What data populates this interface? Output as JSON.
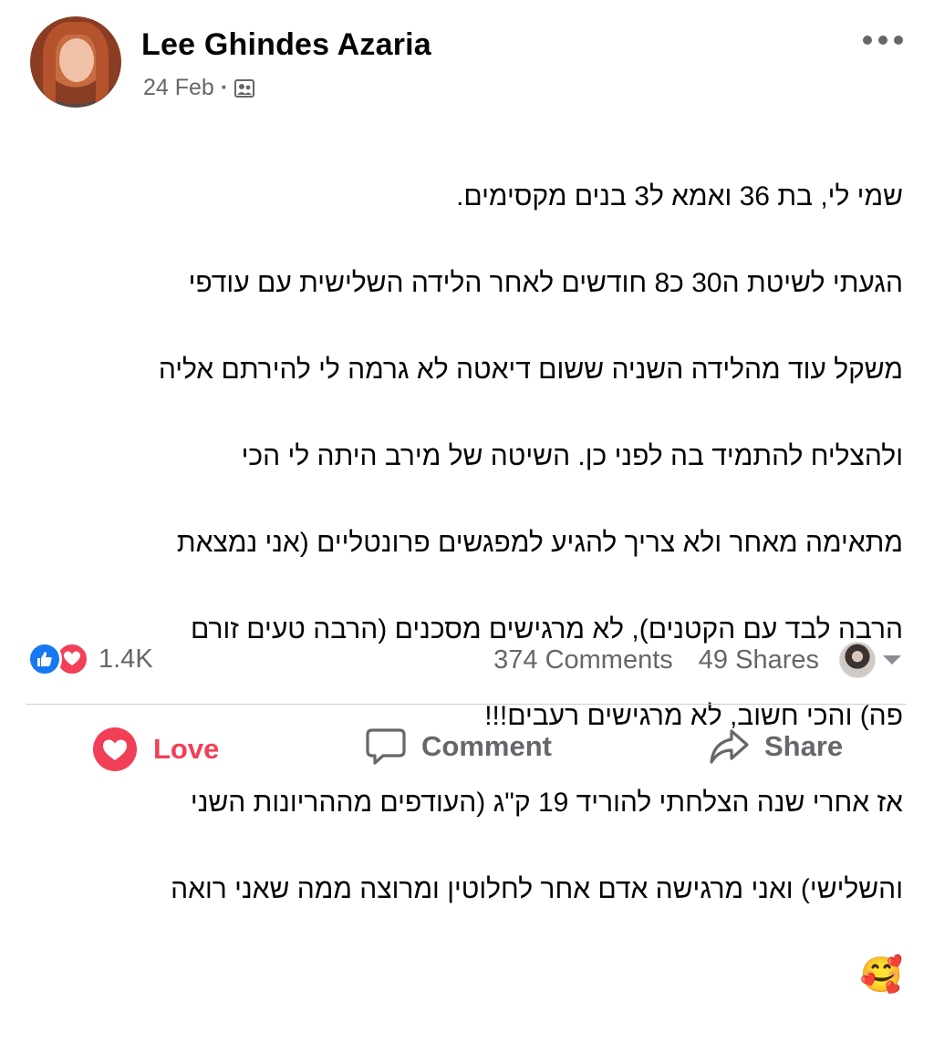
{
  "post": {
    "author": "Lee Ghindes Azaria",
    "date": "24 Feb",
    "separator": "·",
    "text_lines": [
      "שמי לי, בת 36 ואמא ל3 בנים מקסימים.",
      "הגעתי לשיטת ה30 כ8 חודשים לאחר הלידה השלישית עם עודפי",
      "משקל עוד מהלידה השניה ששום דיאטה לא גרמה לי להירתם אליה",
      "ולהצליח להתמיד בה לפני כן. השיטה של מירב היתה לי הכי",
      "מתאימה מאחר ולא צריך להגיע למפגשים פרונטליים (אני נמצאת",
      "הרבה לבד עם הקטנים), לא מרגישים מסכנים (הרבה טעים זורם",
      "פה) והכי חשוב, לא מרגישים רעבים!!!",
      "אז אחרי שנה הצלחתי להוריד 19 ק\"ג (העודפים מההריונות השני",
      "והשלישי) ואני מרגישה אדם אחר לחלוטין ומרוצה ממה שאני רואה"
    ],
    "emoji": "🥰"
  },
  "stats": {
    "reaction_count": "1.4K",
    "comments": "374 Comments",
    "shares": "49 Shares"
  },
  "actions": {
    "love": "Love",
    "comment": "Comment",
    "share": "Share"
  },
  "colors": {
    "love_red": "#f33e58",
    "like_blue": "#1877f2",
    "secondary_text": "#65676b"
  }
}
